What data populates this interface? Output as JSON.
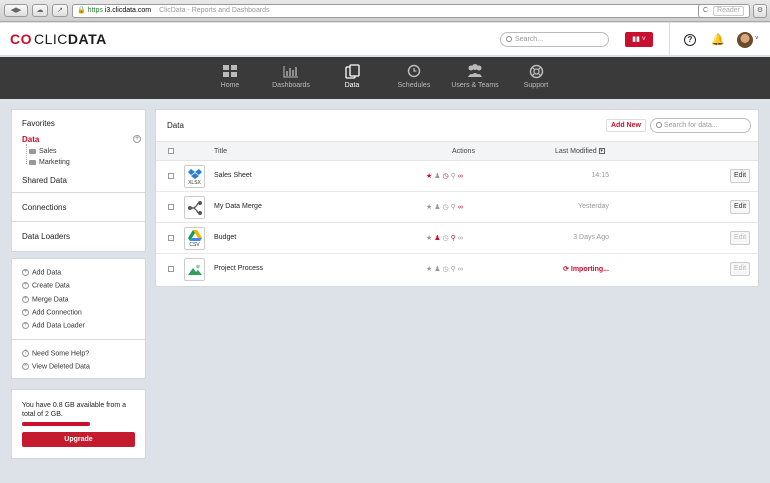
{
  "browser": {
    "url_scheme": "https",
    "url_domain": "i3.clicdata.com",
    "tab_title": "ClicData - Reports and Dashboards",
    "reader_label": "Reader",
    "reload_glyph": "C"
  },
  "header": {
    "logo_mark": "CO",
    "logo_text": "CLIC",
    "logo_bold": "DATA",
    "search_placeholder": "Search...",
    "help_glyph": "?",
    "bell_glyph": "♪"
  },
  "nav": {
    "items": [
      {
        "label": "Home",
        "icon": "home-grid-icon"
      },
      {
        "label": "Dashboards",
        "icon": "bar-chart-icon"
      },
      {
        "label": "Data",
        "icon": "data-files-icon",
        "active": true
      },
      {
        "label": "Schedules",
        "icon": "clock-icon"
      },
      {
        "label": "Users & Teams",
        "icon": "users-icon"
      },
      {
        "label": "Support",
        "icon": "lifebuoy-icon"
      }
    ]
  },
  "sidebar": {
    "favorites": "Favorites",
    "data": "Data",
    "folders": [
      "Sales",
      "Marketing"
    ],
    "shared_data": "Shared Data",
    "connections": "Connections",
    "data_loaders": "Data Loaders",
    "actions": [
      "Add Data",
      "Create Data",
      "Merge Data",
      "Add Connection",
      "Add Data Loader"
    ],
    "help_links": [
      "Need Some Help?",
      "View Deleted Data"
    ],
    "storage": {
      "text": "You have 0.8 GB available from a total of 2 GB.",
      "used_fraction": 0.6,
      "upgrade_label": "Upgrade"
    }
  },
  "main": {
    "title": "Data",
    "add_new_label": "Add New",
    "search_placeholder": "Search for data...",
    "columns": {
      "title": "Title",
      "actions": "Actions",
      "last_modified": "Last Modified"
    },
    "rows": [
      {
        "title": "Sales Sheet",
        "icon": "dropbox-xlsx-icon",
        "ext": "XLSX",
        "last_modified": "14:15",
        "edit": "Edit",
        "edit_enabled": true,
        "favorite": true
      },
      {
        "title": "My Data Merge",
        "icon": "merge-icon",
        "ext": "",
        "last_modified": "Yesterday",
        "edit": "Edit",
        "edit_enabled": true,
        "favorite": false
      },
      {
        "title": "Budget",
        "icon": "google-drive-csv-icon",
        "ext": "CSV",
        "last_modified": "3 Days Ago",
        "edit": "Edit",
        "edit_enabled": false,
        "favorite": false
      },
      {
        "title": "Project Process",
        "icon": "image-file-icon",
        "ext": "",
        "last_modified": "Importing...",
        "edit": "Edit",
        "edit_enabled": false,
        "favorite": false
      }
    ]
  },
  "colors": {
    "accent": "#c8102e",
    "nav_bg": "#3a3a3a",
    "page_bg": "#dde2e8"
  }
}
